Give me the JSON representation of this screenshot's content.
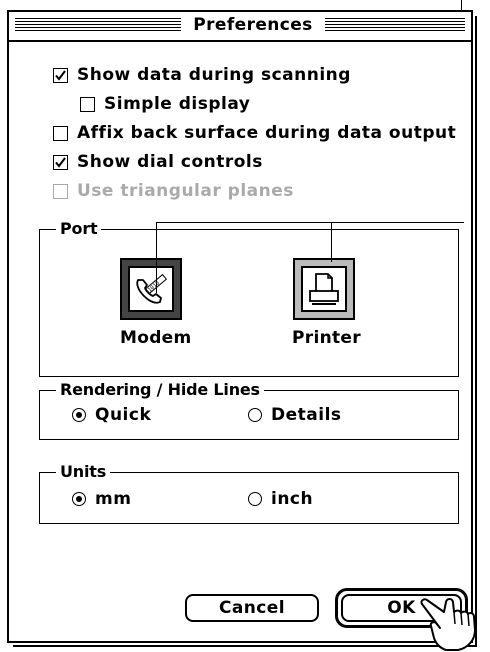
{
  "window": {
    "title": "Preferences"
  },
  "options": {
    "show_data_during_scanning": {
      "label": "Show data during scanning",
      "checked": true
    },
    "simple_display": {
      "label": "Simple display",
      "checked": false
    },
    "affix_back_surface": {
      "label": "Affix back surface during data output",
      "checked": false
    },
    "show_dial_controls": {
      "label": "Show dial controls",
      "checked": true
    },
    "use_triangular_planes": {
      "label": "Use triangular planes",
      "checked": false,
      "enabled": false
    }
  },
  "port": {
    "group_label": "Port",
    "items": [
      {
        "label": "Modem",
        "icon": "modem-telephone-icon",
        "selected": true
      },
      {
        "label": "Printer",
        "icon": "printer-icon",
        "selected": false
      }
    ]
  },
  "rendering": {
    "group_label": "Rendering / Hide Lines",
    "options": [
      {
        "label": "Quick",
        "selected": true
      },
      {
        "label": "Details",
        "selected": false
      }
    ]
  },
  "units": {
    "group_label": "Units",
    "options": [
      {
        "label": "mm",
        "selected": true
      },
      {
        "label": "inch",
        "selected": false
      }
    ]
  },
  "buttons": {
    "cancel": "Cancel",
    "ok": "OK"
  },
  "pointer": {
    "icon": "pointing-hand-cursor-icon"
  }
}
